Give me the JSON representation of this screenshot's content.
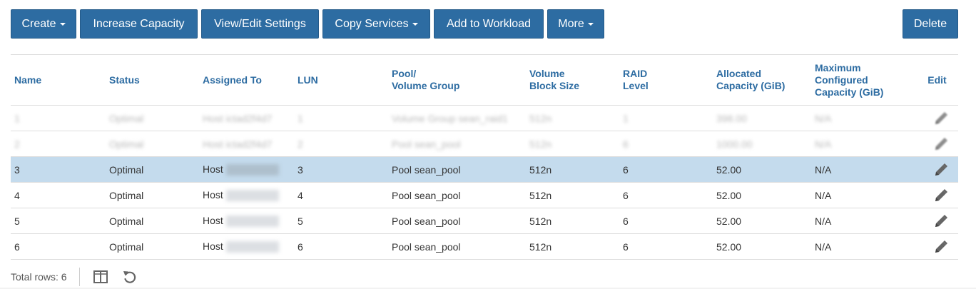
{
  "toolbar": {
    "create": "Create",
    "increase_capacity": "Increase Capacity",
    "view_edit_settings": "View/Edit Settings",
    "copy_services": "Copy Services",
    "add_to_workload": "Add to Workload",
    "more": "More",
    "delete": "Delete"
  },
  "table": {
    "headers": {
      "name": "Name",
      "status": "Status",
      "assigned_to": "Assigned To",
      "lun": "LUN",
      "pool_l1": "Pool/",
      "pool_l2": "Volume Group",
      "block_l1": "Volume",
      "block_l2": "Block Size",
      "raid_l1": "RAID",
      "raid_l2": "Level",
      "alloc_l1": "Allocated",
      "alloc_l2": "Capacity (GiB)",
      "max_l1": "Maximum",
      "max_l2": "Configured",
      "max_l3": "Capacity (GiB)",
      "edit": "Edit"
    },
    "rows": [
      {
        "name": "1",
        "status": "Optimal",
        "assigned_to": "Host ictad2f4d7",
        "lun": "1",
        "pool": "Volume Group sean_raid1",
        "block_size": "512n",
        "raid": "1",
        "allocated": "398.00",
        "max_capacity": "N/A"
      },
      {
        "name": "2",
        "status": "Optimal",
        "assigned_to": "Host ictad2f4d7",
        "lun": "2",
        "pool": "Pool sean_pool",
        "block_size": "512n",
        "raid": "6",
        "allocated": "1000.00",
        "max_capacity": "N/A"
      },
      {
        "name": "3",
        "status": "Optimal",
        "assigned_to": "Host",
        "lun": "3",
        "pool": "Pool sean_pool",
        "block_size": "512n",
        "raid": "6",
        "allocated": "52.00",
        "max_capacity": "N/A"
      },
      {
        "name": "4",
        "status": "Optimal",
        "assigned_to": "Host",
        "lun": "4",
        "pool": "Pool sean_pool",
        "block_size": "512n",
        "raid": "6",
        "allocated": "52.00",
        "max_capacity": "N/A"
      },
      {
        "name": "5",
        "status": "Optimal",
        "assigned_to": "Host",
        "lun": "5",
        "pool": "Pool sean_pool",
        "block_size": "512n",
        "raid": "6",
        "allocated": "52.00",
        "max_capacity": "N/A"
      },
      {
        "name": "6",
        "status": "Optimal",
        "assigned_to": "Host",
        "lun": "6",
        "pool": "Pool sean_pool",
        "block_size": "512n",
        "raid": "6",
        "allocated": "52.00",
        "max_capacity": "N/A"
      }
    ]
  },
  "footer": {
    "total_rows": "Total rows: 6"
  },
  "icons": {
    "edit": "pencil-icon",
    "columns": "column-chooser-icon",
    "refresh": "refresh-icon"
  },
  "colors": {
    "button": "#2d6ca2",
    "header_text": "#2d6ca2",
    "selected_row": "#c4dbed"
  }
}
